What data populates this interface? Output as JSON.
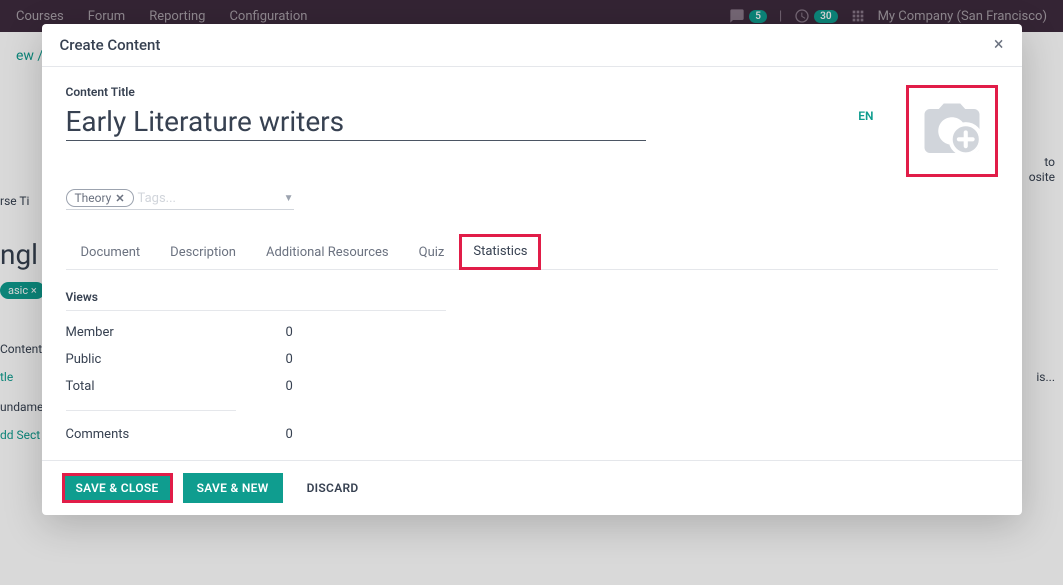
{
  "nav": {
    "items": [
      "Courses",
      "Forum",
      "Reporting",
      "Configuration"
    ],
    "badge1": "5",
    "badge2": "30",
    "company": "My Company (San Francisco)"
  },
  "breadcrumb": "ew / N",
  "modal": {
    "title": "Create Content",
    "content_title_label": "Content Title",
    "content_title_value": "Early Literature writers",
    "lang": "EN",
    "tag": "Theory",
    "tags_placeholder": "Tags...",
    "tabs": {
      "document": "Document",
      "description": "Description",
      "additional": "Additional Resources",
      "quiz": "Quiz",
      "statistics": "Statistics"
    },
    "stats": {
      "views_header": "Views",
      "rows": [
        {
          "label": "Member",
          "value": "0"
        },
        {
          "label": "Public",
          "value": "0"
        },
        {
          "label": "Total",
          "value": "0"
        }
      ],
      "comments_label": "Comments",
      "comments_value": "0"
    },
    "footer": {
      "save_close": "SAVE & CLOSE",
      "save_new": "SAVE & NEW",
      "discard": "DISCARD"
    }
  },
  "bg": {
    "course_title": "rse Ti",
    "course_val": "ngl",
    "basic": "asic ×",
    "content": "Content",
    "tle": "tle",
    "fundame": "undame",
    "add_sect": "dd Sect",
    "goto": "to",
    "website": "osite",
    "is": "is..."
  }
}
